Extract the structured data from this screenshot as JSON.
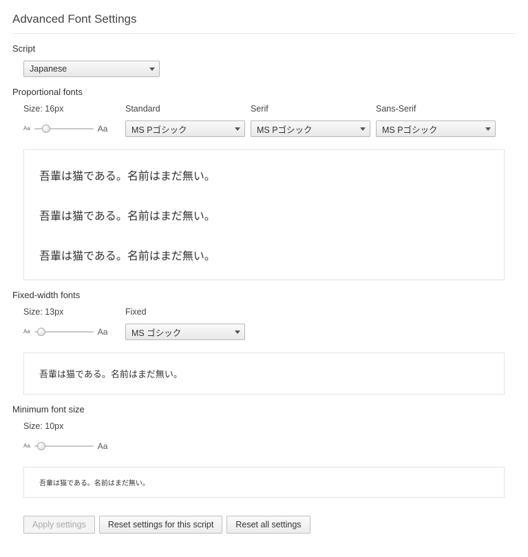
{
  "page": {
    "title": "Advanced Font Settings"
  },
  "script": {
    "label": "Script",
    "value": "Japanese"
  },
  "proportional": {
    "label": "Proportional fonts",
    "size_label": "Size: 16px",
    "standard_label": "Standard",
    "serif_label": "Serif",
    "sans_label": "Sans-Serif",
    "standard_value": "MS Pゴシック",
    "serif_value": "MS Pゴシック",
    "sans_value": "MS Pゴシック",
    "slider_pos_pct": 20,
    "preview_line": "吾輩は猫である。名前はまだ無い。"
  },
  "fixed": {
    "label": "Fixed-width fonts",
    "size_label": "Size: 13px",
    "fixed_label": "Fixed",
    "fixed_value": "MS ゴシック",
    "slider_pos_pct": 12,
    "preview_line": "吾輩は猫である。名前はまだ無い。"
  },
  "minimum": {
    "label": "Minimum font size",
    "size_label": "Size: 10px",
    "slider_pos_pct": 12,
    "preview_line": "吾輩は猫である。名前はまだ無い。"
  },
  "buttons": {
    "apply": "Apply settings",
    "reset_script": "Reset settings for this script",
    "reset_all": "Reset all settings"
  },
  "glyphs": {
    "aa": "Aa"
  }
}
